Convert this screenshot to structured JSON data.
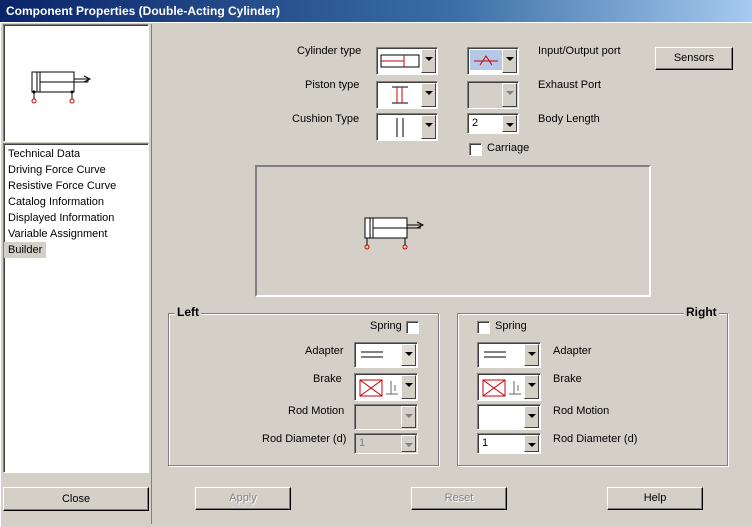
{
  "window": {
    "title": "Component Properties (Double-Acting Cylinder)"
  },
  "sidebar": {
    "items": [
      {
        "label": "Technical Data"
      },
      {
        "label": "Driving Force Curve"
      },
      {
        "label": "Resistive Force Curve"
      },
      {
        "label": "Catalog Information"
      },
      {
        "label": "Displayed Information"
      },
      {
        "label": "Variable Assignment"
      },
      {
        "label": "Builder",
        "selected": true
      }
    ],
    "close_label": "Close"
  },
  "builder": {
    "cylinder_type_label": "Cylinder type",
    "piston_type_label": "Piston type",
    "cushion_type_label": "Cushion Type",
    "io_port_label": "Input/Output port",
    "exhaust_port_label": "Exhaust Port",
    "body_length_label": "Body Length",
    "body_length_value": "2",
    "carriage_label": "Carriage",
    "carriage_checked": false,
    "sensors_label": "Sensors",
    "accent_color": "#cc0000"
  },
  "left_group": {
    "title": "Left",
    "spring_label": "Spring",
    "spring_checked": false,
    "adapter_label": "Adapter",
    "brake_label": "Brake",
    "rod_motion_label": "Rod Motion",
    "rod_diameter_label": "Rod Diameter (d)",
    "rod_diameter_value": "1"
  },
  "right_group": {
    "title": "Right",
    "spring_label": "Spring",
    "spring_checked": false,
    "adapter_label": "Adapter",
    "brake_label": "Brake",
    "rod_motion_label": "Rod Motion",
    "rod_diameter_label": "Rod Diameter (d)",
    "rod_diameter_value": "1"
  },
  "footer": {
    "apply_label": "Apply",
    "reset_label": "Reset",
    "help_label": "Help"
  }
}
